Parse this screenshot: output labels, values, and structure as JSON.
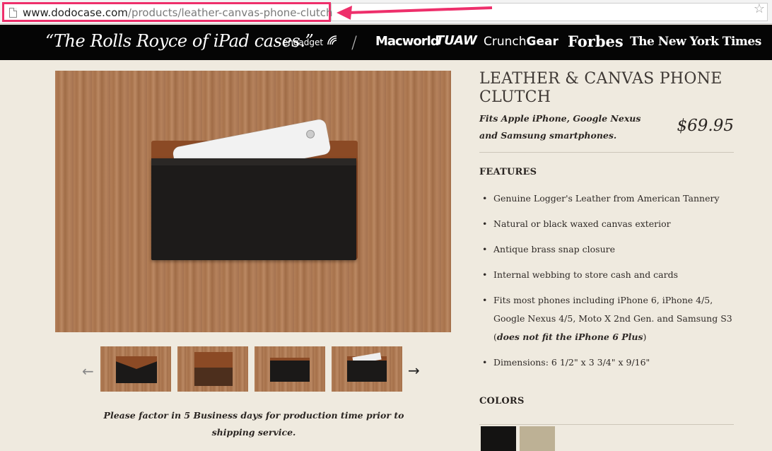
{
  "browser": {
    "url_domain": "www.dodocase.com",
    "url_path": "/products/leather-canvas-phone-clutch",
    "annotation_color": "#ee2f6b"
  },
  "press": {
    "quote": "“The Rolls Royce of iPad cases.”",
    "quote_source": "– engadget",
    "separator": "/",
    "logos": {
      "macworld": "Macworld",
      "tuaw": "TUAW",
      "crunch_prefix": "Crunch",
      "crunch_suffix": "Gear",
      "forbes": "Forbes",
      "nyt": "The New York Times"
    }
  },
  "gallery": {
    "prev_arrow": "←",
    "next_arrow": "→",
    "thumbnail_count": 4
  },
  "shipping_note": "Please factor in 5 Business days for production time prior to shipping service.",
  "product": {
    "title": "LEATHER & CANVAS PHONE CLUTCH",
    "fits": "Fits Apple iPhone, Google Nexus and Samsung smartphones.",
    "price": "$69.95",
    "features_heading": "FEATURES",
    "features": [
      {
        "text": "Genuine Logger's Leather from American Tannery",
        "strong": ""
      },
      {
        "text": "Natural or black waxed canvas exterior",
        "strong": ""
      },
      {
        "text": "Antique brass snap closure",
        "strong": ""
      },
      {
        "text": "Internal webbing to store cash and cards",
        "strong": ""
      },
      {
        "text": "Fits most phones including iPhone 6, iPhone 4/5, Google Nexus 4/5, Moto X 2nd Gen. and Samsung S3 (",
        "strong": "does not fit the iPhone 6 Plus",
        "after": ")"
      },
      {
        "text": "Dimensions: 6 1/2\" x 3 3/4\" x 9/16\"",
        "strong": ""
      }
    ],
    "colors_heading": "COLORS",
    "colors": [
      {
        "name": "black",
        "hex": "#141312"
      },
      {
        "name": "natural",
        "hex": "#bdb195"
      }
    ]
  }
}
